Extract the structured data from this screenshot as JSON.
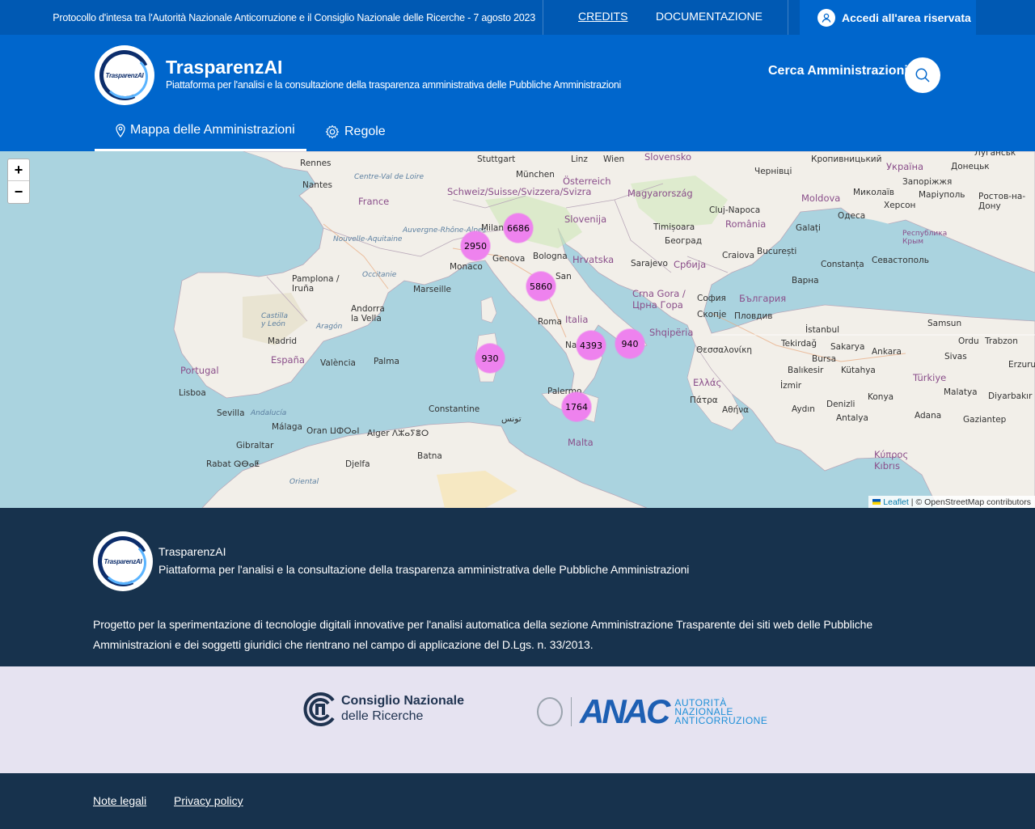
{
  "topbar": {
    "notice": "Protocollo d'intesa tra l'Autorità Nazionale Anticorruzione e il Consiglio Nazionale delle Ricerche - 7 agosto 2023",
    "credits": "CREDITS",
    "documentation": "DOCUMENTAZIONE",
    "login": "Accedi all'area riservata"
  },
  "header": {
    "logo_text": "TrasparenzAI",
    "title": "TrasparenzAI",
    "subtitle": "Piattaforma per l'analisi e la consultazione della trasparenza amministrativa delle Pubbliche Amministrazioni",
    "search_label": "Cerca Amministrazioni"
  },
  "nav": {
    "map": "Mappa delle Amministrazioni",
    "rules": "Regole"
  },
  "map": {
    "zoom_in": "+",
    "zoom_out": "−",
    "clusters": [
      {
        "count": "6686"
      },
      {
        "count": "2950"
      },
      {
        "count": "5860"
      },
      {
        "count": "4393"
      },
      {
        "count": "940"
      },
      {
        "count": "930"
      },
      {
        "count": "1764"
      }
    ],
    "labels": {
      "rennes": "Rennes",
      "nantes": "Nantes",
      "centre": "Centre-Val de Loire",
      "france": "France",
      "nouvelle": "Nouvelle-Aquitaine",
      "auvergne": "Auvergne-Rhône-Alpes",
      "occitanie": "Occitanie",
      "stuttgart": "Stuttgart",
      "munchen": "München",
      "schweiz": "Schweiz/Suisse/Svizzera/Svizra",
      "linz": "Linz",
      "wien": "Wien",
      "osterreich": "Österreich",
      "slovensko": "Slovensko",
      "magyarorszag": "Magyarország",
      "slovenija": "Slovenija",
      "hrvatska": "Hrvatska",
      "milano": "Milano",
      "genova": "Genova",
      "bologna": "Bologna",
      "monaco": "Monaco",
      "marseille": "Marseille",
      "san": "San",
      "italia": "Italia",
      "roma": "Roma",
      "na": "Na",
      "palermo": "Palermo",
      "malta": "Malta",
      "pamplona": "Pamplona / Iruña",
      "andorra": "Andorra la Vella",
      "castilla": "Castilla y León",
      "aragon": "Aragón",
      "madrid": "Madrid",
      "espana": "España",
      "valencia": "València",
      "palma": "Palma",
      "portugal": "Portugal",
      "lisboa": "Lisboa",
      "sevilla": "Sevilla",
      "andalucia": "Andalucía",
      "malaga": "Málaga",
      "gibraltar": "Gibraltar",
      "oran": "Oran ⵡⵀⵔⴰⵏ",
      "alger": "Alger ⴷⵣⴰⵢⴻⵔ",
      "constantine": "Constantine",
      "batna": "Batna",
      "rabat": "Rabat ⵕⴱⴰⵟ",
      "djelfa": "Djelfa",
      "oriental": "Oriental",
      "tunis": "تونس",
      "sarajevo": "Sarajevo",
      "beograd": "Београд",
      "srbija": "Србија",
      "timisoara": "Timișoara",
      "cluj": "Cluj-Napoca",
      "romania": "România",
      "bucuresti": "București",
      "craiova": "Craiova",
      "crnagora": "Crna Gora / Црна Гора",
      "sofia": "София",
      "balgaria": "България",
      "skopje": "Скопје",
      "plovdiv": "Пловдив",
      "shqiperia": "Shqipëria",
      "thessaloniki": "Θεσσαλονίκη",
      "ellas": "Ελλάς",
      "patra": "Πάτρα",
      "athina": "Αθήνα",
      "istanbul": "İstanbul",
      "tekirdag": "Tekirdağ",
      "sakarya": "Sakarya",
      "ankara": "Ankara",
      "bursa": "Bursa",
      "balikesir": "Balıkesir",
      "kutahya": "Kütahya",
      "turkiye": "Türkiye",
      "izmir": "İzmir",
      "denizli": "Denizli",
      "aydin": "Aydın",
      "antalya": "Antalya",
      "konya": "Konya",
      "adana": "Adana",
      "kibris": "Κύπρος Kıbrıs",
      "moldova": "Moldova",
      "odesa": "Одеса",
      "ukraina": "Україна",
      "chernivtsi": "Чернівці",
      "constanta": "Constanța",
      "varna": "Варна",
      "sevastopol": "Севастополь",
      "krym": "Республика Крым",
      "samsun": "Samsun",
      "ordu": "Ordu",
      "trabzon": "Trabzon",
      "erzurum": "Erzurum",
      "sivas": "Sivas",
      "malatya": "Malatya",
      "diyarbakir": "Diyarbakır",
      "gaziantep": "Gaziantep",
      "zaporizhzhia": "Запоріжжя",
      "mykolaiv": "Миколаїв",
      "kherson": "Херсон",
      "donetsk": "Донецьк",
      "mariupol": "Маріуполь",
      "rostov": "Ростов-на-Дону",
      "galati": "Galați",
      "kropyvnytskyi": "Кропивницький",
      "luhansk": "Луганськ"
    },
    "attribution_leaflet": "Leaflet",
    "attribution_osm": "| © OpenStreetMap contributors"
  },
  "footer": {
    "logo_text": "TrasparenzAI",
    "title": "TrasparenzAI",
    "subtitle": "Piattaforma per l'analisi e la consultazione della trasparenza amministrativa delle Pubbliche Amministrazioni",
    "description": "Progetto per la sperimentazione di tecnologie digitali innovative per l'analisi automatica della sezione Amministrazione Trasparente dei siti web delle Pubbliche Amministrazioni e dei soggetti giuridici che rientrano nel campo di applicazione del D.Lgs. n. 33/2013."
  },
  "partners": {
    "cnr_line1": "Consiglio Nazionale",
    "cnr_line2": "delle Ricerche",
    "anac_word": "ANAC",
    "anac_line1": "AUTORITÀ",
    "anac_line2": "NAZIONALE",
    "anac_line3": "ANTICORRUZIONE"
  },
  "legal": {
    "note": "Note legali",
    "privacy": "Privacy policy"
  }
}
